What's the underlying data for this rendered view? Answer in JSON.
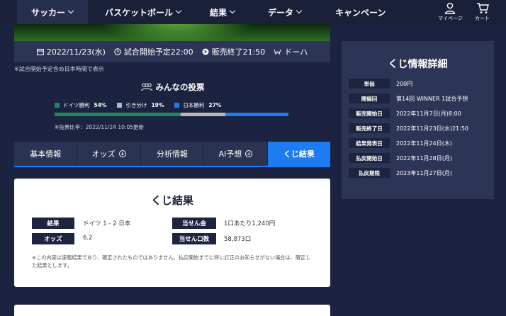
{
  "nav": {
    "items": [
      {
        "label": "サッカー"
      },
      {
        "label": "バスケットボール"
      },
      {
        "label": "結果"
      },
      {
        "label": "データ"
      },
      {
        "label": "キャンペーン"
      }
    ],
    "mypage_label": "マイページ",
    "cart_label": "カート"
  },
  "match": {
    "date": "2022/11/23(水)",
    "start": "試合開始予定22:00",
    "sales_end": "販売終了21:50",
    "venue": "ドーハ",
    "note": "※試合開始予定含め日本時間で表示"
  },
  "vote": {
    "title": "みんなの投票",
    "options": [
      {
        "label": "ドイツ勝利",
        "pct": "54%",
        "color": "#1a8a5a"
      },
      {
        "label": "引き分け",
        "pct": "19%",
        "color": "#b8b8b8"
      },
      {
        "label": "日本勝利",
        "pct": "27%",
        "color": "#1e7cf2"
      }
    ],
    "shares": [
      0.54,
      0.19,
      0.27
    ],
    "updated": "※投票比率：2022/11/24 10:05更新"
  },
  "tabs": [
    {
      "label": "基本情報"
    },
    {
      "label": "オッズ"
    },
    {
      "label": "分析情報"
    },
    {
      "label": "AI予想"
    },
    {
      "label": "くじ結果"
    }
  ],
  "result": {
    "title": "くじ結果",
    "result_label": "結果",
    "result_value": "ドイツ 1 - 2 日本",
    "odds_label": "オッズ",
    "odds_value": "6.2",
    "prize_label": "当せん金",
    "prize_value": "1口あたり1,240円",
    "winners_label": "当せん口数",
    "winners_value": "58,873口",
    "disclaimer": "※この内容は速報結果であり、確定されたものではありません。払戻開始までに特に訂正のお知らせがない場合は、確定した結果とします。"
  },
  "details": {
    "title": "くじ情報詳細",
    "rows": [
      {
        "label": "単価",
        "value": "200円"
      },
      {
        "label": "開催回",
        "value": "第14回 WINNER 1試合予想"
      },
      {
        "label": "販売開始日",
        "value": "2022年11月7日(月)8:00"
      },
      {
        "label": "販売終了日",
        "value": "2022年11月23日(水)21:50"
      },
      {
        "label": "結果発表日",
        "value": "2022年11月24日(木)"
      },
      {
        "label": "払戻開始日",
        "value": "2022年11月28日(月)"
      },
      {
        "label": "払戻期限",
        "value": "2023年11月27日(月)"
      }
    ]
  },
  "colors": {
    "background": "#1c2340",
    "panel": "#2d3556",
    "accent": "#1e7cf2",
    "label_bg": "#1d2440"
  }
}
